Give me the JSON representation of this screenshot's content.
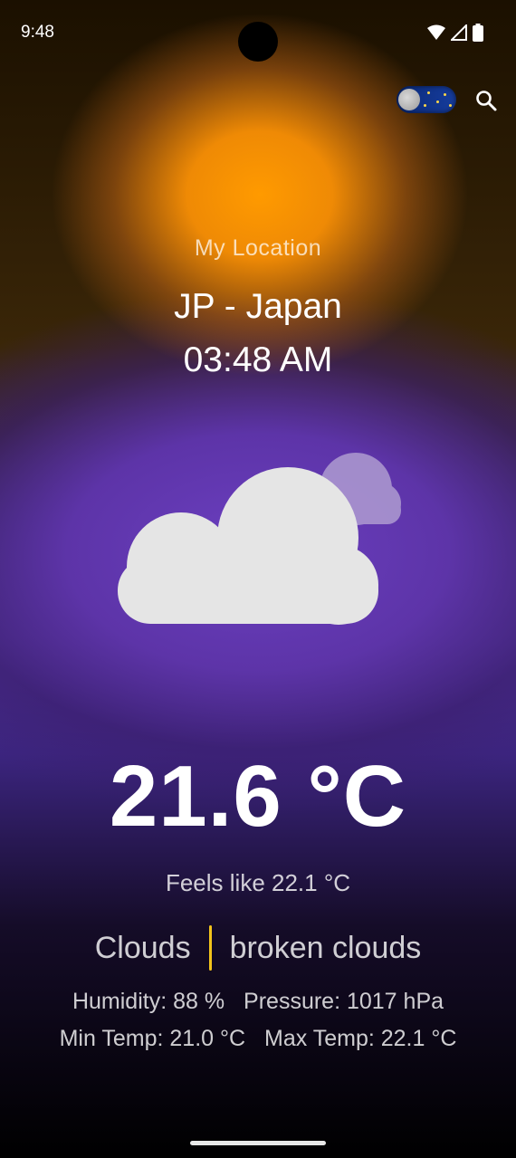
{
  "status_bar": {
    "time": "9:48",
    "icons": [
      "wifi-icon",
      "signal-icon",
      "battery-icon"
    ]
  },
  "header": {
    "theme_toggle_icon": "moon-stars-toggle",
    "search_icon": "search-icon"
  },
  "location": {
    "label": "My Location",
    "city": "JP - Japan",
    "local_time": "03:48 AM"
  },
  "weather": {
    "icon": "broken-clouds-icon",
    "temperature": "21.6 °C",
    "feels_like": "Feels like 22.1 °C",
    "main": "Clouds",
    "description": "broken clouds",
    "humidity": "Humidity: 88 %",
    "pressure": "Pressure: 1017 hPa",
    "min_temp": "Min Temp: 21.0 °C",
    "max_temp": "Max Temp: 22.1 °C"
  },
  "colors": {
    "sun_glow": "#ff9a00",
    "purple_glow": "#6b3fc0",
    "divider": "#f2c31b",
    "background": "#000000"
  }
}
